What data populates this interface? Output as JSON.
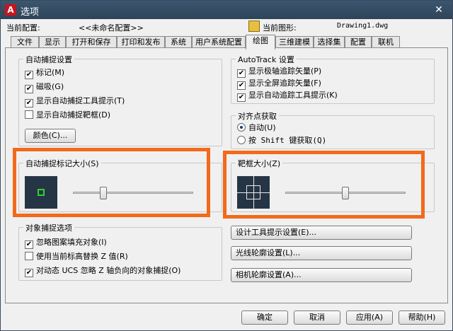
{
  "window": {
    "title": "选项",
    "close_glyph": "✕",
    "app_icon": "A"
  },
  "header": {
    "current_config_label": "当前配置:",
    "current_config_value": "<<未命名配置>>",
    "current_drawing_label": "当前图形:",
    "current_drawing_value": "Drawing1.dwg"
  },
  "tabs": [
    "文件",
    "显示",
    "打开和保存",
    "打印和发布",
    "系统",
    "用户系统配置",
    "绘图",
    "三维建模",
    "选择集",
    "配置",
    "联机"
  ],
  "active_tab": "绘图",
  "autosnap": {
    "title": "自动捕捉设置",
    "marker": "标记(M)",
    "magnet": "磁吸(G)",
    "tooltip": "显示自动捕捉工具提示(T)",
    "aperture": "显示自动捕捉靶框(D)",
    "color_button": "颜色(C)...",
    "checked": {
      "marker": true,
      "magnet": true,
      "tooltip": true,
      "aperture": false
    }
  },
  "autotrack": {
    "title": "AutoTrack 设置",
    "polar": "显示极轴追踪矢量(P)",
    "fullscreen": "显示全屏追踪矢量(F)",
    "tooltip": "显示自动追踪工具提示(K)"
  },
  "alignment": {
    "title": "对齐点获取",
    "auto": "自动(U)",
    "shift": "按 Shift 键获取(Q)",
    "selected": "auto"
  },
  "marker_size": {
    "title": "自动捕捉标记大小(S)",
    "level": 0.25
  },
  "aperture_size": {
    "title": "靶框大小(Z)",
    "level": 0.5
  },
  "osnap": {
    "title": "对象捕捉选项",
    "ignore_hatch": "忽略图案填充对象(I)",
    "replace_z": "使用当前标高替换 Z 值(R)",
    "ignore_neg_z": "对动态 UCS 忽略 Z 轴负向的对象捕捉(O)"
  },
  "side_buttons": {
    "design_tooltip": "设计工具提示设置(E)...",
    "light_glyph": "光线轮廓设置(L)...",
    "camera_glyph": "相机轮廓设置(A)..."
  },
  "footer": {
    "ok": "确定",
    "cancel": "取消",
    "apply": "应用(A)",
    "help": "帮助(H)"
  },
  "colors": {
    "highlight": "#f26a1b",
    "marker": "#2fd02f",
    "preview_bg": "#263545",
    "titlebar": "#34495e"
  },
  "check_glyph": "✔"
}
